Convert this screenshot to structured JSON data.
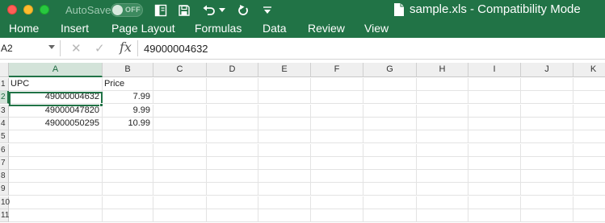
{
  "titlebar": {
    "autosave_label": "AutoSave",
    "autosave_state": "OFF",
    "document_title": "sample.xls  -  Compatibility Mode",
    "icons": [
      "sidebar-icon",
      "save-icon",
      "undo-icon",
      "redo-icon",
      "customize-toolbar-icon",
      "document-icon"
    ]
  },
  "ribbon": {
    "tabs": [
      {
        "label": "Home"
      },
      {
        "label": "Insert"
      },
      {
        "label": "Page Layout"
      },
      {
        "label": "Formulas"
      },
      {
        "label": "Data"
      },
      {
        "label": "Review"
      },
      {
        "label": "View"
      }
    ]
  },
  "formula_bar": {
    "name_box": "A2",
    "cancel_symbol": "✕",
    "enter_symbol": "✓",
    "fx_symbol": "fx",
    "formula_value": "49000004632"
  },
  "sheet": {
    "columns": [
      "A",
      "B",
      "C",
      "D",
      "E",
      "F",
      "G",
      "H",
      "I",
      "J",
      "K"
    ],
    "rows": [
      "1",
      "2",
      "3",
      "4",
      "5",
      "6",
      "7",
      "8",
      "9",
      "10",
      "11"
    ],
    "selected_cell": "A2",
    "cells": [
      {
        "ref": "A1",
        "value": "UPC",
        "type": "text"
      },
      {
        "ref": "B1",
        "value": "Price",
        "type": "text"
      },
      {
        "ref": "A2",
        "value": "49000004632",
        "type": "number"
      },
      {
        "ref": "B2",
        "value": "7.99",
        "type": "number"
      },
      {
        "ref": "A3",
        "value": "49000047820",
        "type": "number"
      },
      {
        "ref": "B3",
        "value": "9.99",
        "type": "number"
      },
      {
        "ref": "A4",
        "value": "49000050295",
        "type": "number"
      },
      {
        "ref": "B4",
        "value": "10.99",
        "type": "number"
      }
    ]
  },
  "colors": {
    "accent": "#217346",
    "title_text": "#ffffff",
    "header_bg": "#efefef"
  }
}
